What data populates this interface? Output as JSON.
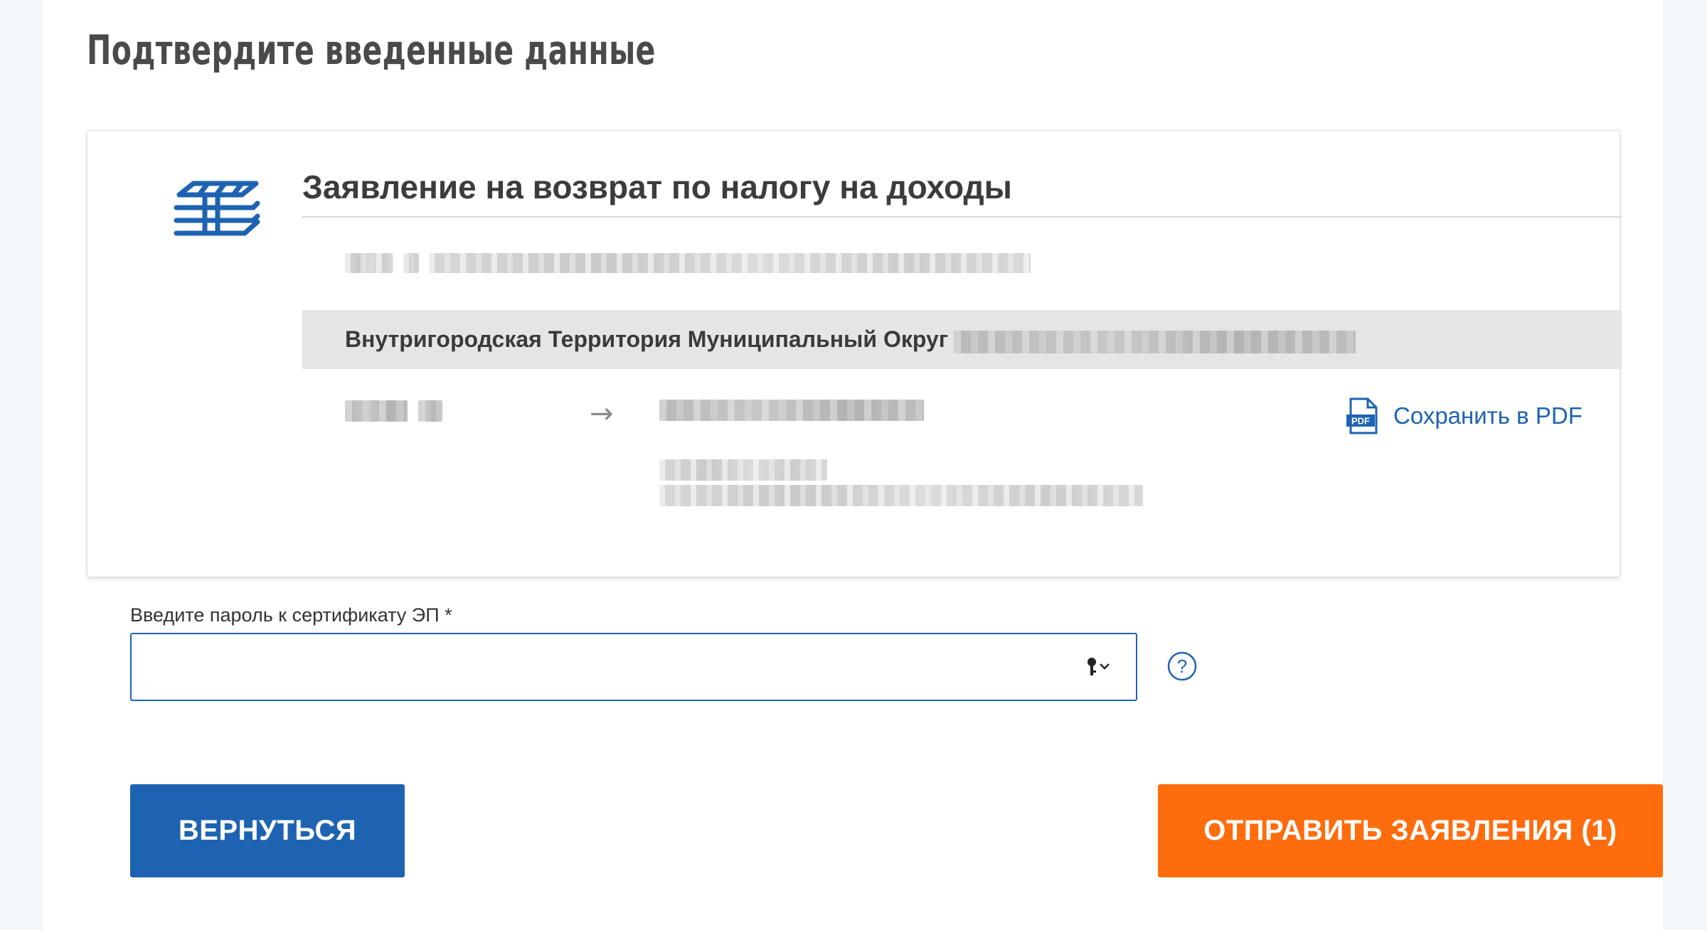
{
  "page": {
    "title": "Подтвердите введенные данные"
  },
  "card": {
    "icon": "building-icon",
    "title": "Заявление на возврат по налогу на доходы",
    "territory_label": "Внутригородская Территория Муниципальный Округ",
    "arrow_icon": "arrow-right-icon",
    "pdf_icon": "pdf-file-icon",
    "pdf_label": "Сохранить в PDF"
  },
  "password": {
    "label": "Введите пароль к сертификату ЭП *",
    "value": "",
    "placeholder": "",
    "key_icon": "key-dropdown-icon",
    "help_icon": "question-circle-icon"
  },
  "actions": {
    "back_label": "ВЕРНУТЬСЯ",
    "submit_label": "ОТПРАВИТЬ ЗАЯВЛЕНИЯ (1)"
  },
  "colors": {
    "primary": "#1e63b1",
    "accent": "#ff6c0d",
    "background": "#f4f7fa"
  }
}
